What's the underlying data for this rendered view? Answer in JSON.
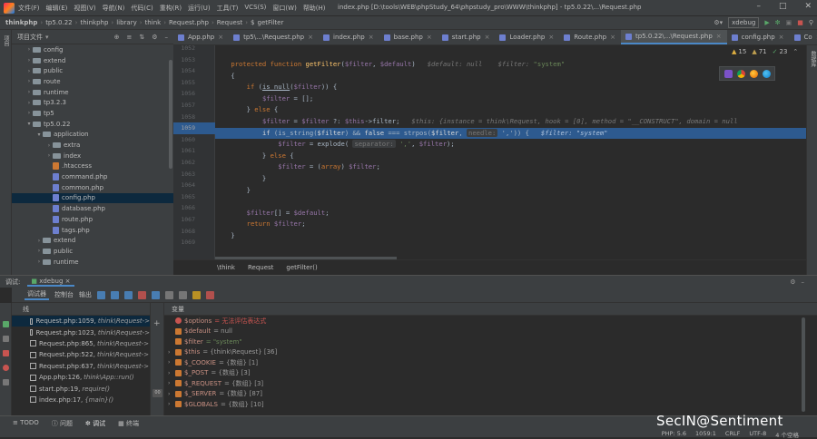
{
  "titlebar": {
    "menu": [
      "文件(F)",
      "编辑(E)",
      "视图(V)",
      "导航(N)",
      "代码(C)",
      "重构(R)",
      "运行(U)",
      "工具(T)",
      "VCS(S)",
      "窗口(W)",
      "帮助(H)"
    ],
    "title": "index.php [D:\\tools\\WEB\\phpStudy_64\\phpstudy_pro\\WWW\\thinkphp] - tp5.0.22\\...\\Request.php"
  },
  "navbar": {
    "crumbs": [
      "thinkphp",
      "tp5.0.22",
      "thinkphp",
      "library",
      "think",
      "Request.php",
      "Request",
      "$",
      "getFilter"
    ],
    "run_config": "xdebug"
  },
  "project": {
    "title": "项目文件",
    "sidebar_label": "项目"
  },
  "tree": [
    {
      "label": "config",
      "depth": 1,
      "kind": "folder",
      "exp": false
    },
    {
      "label": "extend",
      "depth": 1,
      "kind": "folder",
      "exp": false
    },
    {
      "label": "public",
      "depth": 1,
      "kind": "folder",
      "exp": false
    },
    {
      "label": "route",
      "depth": 1,
      "kind": "folder",
      "exp": false
    },
    {
      "label": "runtime",
      "depth": 1,
      "kind": "folder",
      "exp": false
    },
    {
      "label": "tp3.2.3",
      "depth": 1,
      "kind": "folder",
      "exp": false
    },
    {
      "label": "tp5",
      "depth": 1,
      "kind": "folder",
      "exp": false
    },
    {
      "label": "tp5.0.22",
      "depth": 1,
      "kind": "folder",
      "exp": true
    },
    {
      "label": "application",
      "depth": 2,
      "kind": "folder",
      "exp": true
    },
    {
      "label": "extra",
      "depth": 3,
      "kind": "folder",
      "exp": false
    },
    {
      "label": "index",
      "depth": 3,
      "kind": "folder",
      "exp": false
    },
    {
      "label": ".htaccess",
      "depth": 3,
      "kind": "ht",
      "exp": null
    },
    {
      "label": "command.php",
      "depth": 3,
      "kind": "php",
      "exp": null
    },
    {
      "label": "common.php",
      "depth": 3,
      "kind": "php",
      "exp": null
    },
    {
      "label": "config.php",
      "depth": 3,
      "kind": "php",
      "exp": null,
      "selected": true
    },
    {
      "label": "database.php",
      "depth": 3,
      "kind": "php",
      "exp": null
    },
    {
      "label": "route.php",
      "depth": 3,
      "kind": "php",
      "exp": null
    },
    {
      "label": "tags.php",
      "depth": 3,
      "kind": "php",
      "exp": null
    },
    {
      "label": "extend",
      "depth": 2,
      "kind": "folder",
      "exp": false
    },
    {
      "label": "public",
      "depth": 2,
      "kind": "folder",
      "exp": false
    },
    {
      "label": "runtime",
      "depth": 2,
      "kind": "folder",
      "exp": false
    }
  ],
  "tabs": [
    "App.php",
    "tp5\\...\\Request.php",
    "index.php",
    "base.php",
    "start.php",
    "Loader.php",
    "Route.php",
    "tp5.0.22\\...\\Request.php",
    "config.php",
    "Co"
  ],
  "active_tab": 7,
  "inspections": {
    "warnings": "15",
    "weak": "71",
    "typos": "23"
  },
  "gutter": [
    "1052",
    "1053",
    "1054",
    "1055",
    "1056",
    "1057",
    "1058",
    "1059",
    "1060",
    "1061",
    "1062",
    "1063",
    "1064",
    "1065",
    "1066",
    "1067",
    "1068",
    "1069"
  ],
  "editor_breadcrumb": [
    "\\think",
    "Request",
    "getFilter()"
  ],
  "debug": {
    "title": "调试:",
    "config": "xdebug",
    "tabs": [
      "调试器",
      "控制台",
      "输出"
    ],
    "thread_label": "线",
    "vars_label": "变量",
    "right_label": "数据库"
  },
  "frames": [
    {
      "file": "Request.php:1059,",
      "ctx": "think\\Request->"
    },
    {
      "file": "Request.php:1023,",
      "ctx": "think\\Request->"
    },
    {
      "file": "Request.php:865,",
      "ctx": "think\\Request->"
    },
    {
      "file": "Request.php:522,",
      "ctx": "think\\Request->"
    },
    {
      "file": "Request.php:637,",
      "ctx": "think\\Request->"
    },
    {
      "file": "App.php:126,",
      "ctx": "think\\App::run()"
    },
    {
      "file": "start.php:19,",
      "ctx": "require()"
    },
    {
      "file": "index.php:17,",
      "ctx": "{main}()"
    }
  ],
  "variables": [
    {
      "name": "$options",
      "value": "= 无法评估表达式",
      "kind": "err",
      "exp": false
    },
    {
      "name": "$default",
      "value": "= null",
      "kind": "f",
      "exp": false
    },
    {
      "name": "$filter",
      "value": "= \"system\"",
      "kind": "f",
      "exp": false,
      "str": true
    },
    {
      "name": "$this",
      "value": "= {think\\Request} [36]",
      "kind": "f",
      "exp": true
    },
    {
      "name": "$_COOKIE",
      "value": "= {数组} [1]",
      "kind": "f",
      "exp": true
    },
    {
      "name": "$_POST",
      "value": "= {数组} [3]",
      "kind": "f",
      "exp": true
    },
    {
      "name": "$_REQUEST",
      "value": "= {数组} [3]",
      "kind": "f",
      "exp": true
    },
    {
      "name": "$_SERVER",
      "value": "= {数组} [87]",
      "kind": "f",
      "exp": true
    },
    {
      "name": "$GLOBALS",
      "value": "= {数组} [10]",
      "kind": "f",
      "exp": true
    }
  ],
  "statusbar": {
    "tools": [
      "TODO",
      "问题",
      "调试",
      "终端"
    ],
    "info": [
      "PHP: 5.6",
      "1059:1",
      "CRLF",
      "UTF-8",
      "4 个空格"
    ]
  },
  "watermark": "SecIN@Sentiment"
}
